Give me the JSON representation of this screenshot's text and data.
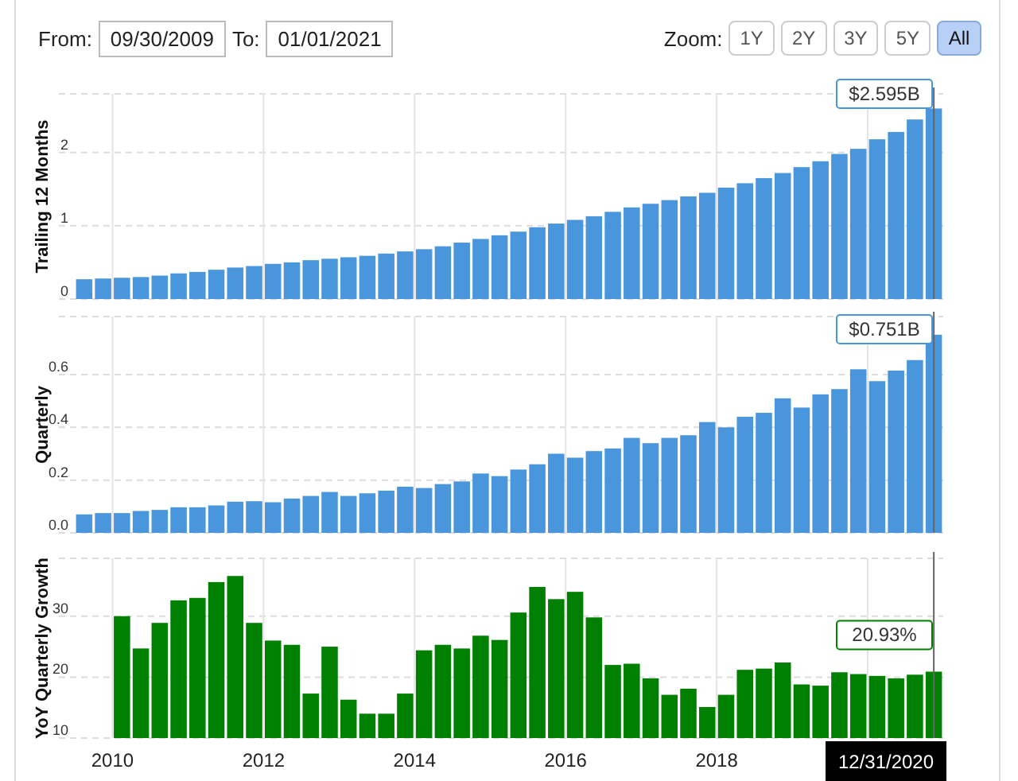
{
  "date_range": {
    "from_label": "From:",
    "from": "09/30/2009",
    "to_label": "To:",
    "to": "01/01/2021"
  },
  "zoom": {
    "label": "Zoom:",
    "options": [
      {
        "label": "1Y",
        "selected": false
      },
      {
        "label": "2Y",
        "selected": false
      },
      {
        "label": "3Y",
        "selected": false
      },
      {
        "label": "5Y",
        "selected": false
      },
      {
        "label": "All",
        "selected": true
      }
    ]
  },
  "charts": [
    {
      "tooltip": "$2.595B",
      "chart_data": {
        "type": "bar",
        "ylabel": "Trailing 12 Months",
        "grid": true,
        "ylim": [
          0,
          2.8
        ],
        "yticks": [
          0,
          1,
          2
        ],
        "series": [
          {
            "color": "#4a96dc",
            "values": [
              0.27,
              0.28,
              0.29,
              0.3,
              0.32,
              0.35,
              0.37,
              0.4,
              0.43,
              0.45,
              0.48,
              0.5,
              0.53,
              0.55,
              0.57,
              0.59,
              0.62,
              0.65,
              0.68,
              0.72,
              0.77,
              0.82,
              0.87,
              0.92,
              0.98,
              1.03,
              1.08,
              1.13,
              1.19,
              1.25,
              1.3,
              1.35,
              1.4,
              1.45,
              1.52,
              1.58,
              1.65,
              1.72,
              1.8,
              1.88,
              1.98,
              2.05,
              2.18,
              2.28,
              2.45,
              2.6
            ]
          }
        ]
      }
    },
    {
      "tooltip": "$0.751B",
      "chart_data": {
        "type": "bar",
        "ylabel": "Quarterly",
        "grid": true,
        "ylim": [
          0,
          0.82
        ],
        "yticks": [
          {
            "value": 0,
            "label": "0.0"
          },
          0.2,
          0.4,
          0.6
        ],
        "series": [
          {
            "color": "#4a96dc",
            "values": [
              0.07,
              0.075,
              0.075,
              0.083,
              0.087,
              0.097,
              0.097,
              0.104,
              0.118,
              0.12,
              0.116,
              0.13,
              0.14,
              0.155,
              0.14,
              0.15,
              0.16,
              0.175,
              0.17,
              0.185,
              0.195,
              0.225,
              0.215,
              0.24,
              0.26,
              0.3,
              0.285,
              0.31,
              0.32,
              0.36,
              0.34,
              0.36,
              0.37,
              0.42,
              0.4,
              0.44,
              0.455,
              0.51,
              0.475,
              0.525,
              0.545,
              0.62,
              0.575,
              0.615,
              0.655,
              0.751
            ]
          }
        ]
      }
    },
    {
      "tooltip": "20.93%",
      "x_axis_labels": [
        "2010",
        "2012",
        "2014",
        "2016",
        "2018"
      ],
      "chart_data": {
        "type": "bar",
        "ylabel": "YoY Quarterly Growth",
        "grid": true,
        "ylim": [
          10,
          39.5
        ],
        "yticks": [
          10,
          20,
          30
        ],
        "series": [
          {
            "color": "#008000",
            "values": [
              null,
              null,
              30,
              24.7,
              28.9,
              32.6,
              33,
              35.6,
              36.6,
              28.9,
              26,
              25.3,
              17.3,
              25,
              16.3,
              14,
              14,
              17.3,
              24.4,
              25.3,
              24.7,
              26.8,
              26.1,
              30.6,
              34.8,
              32.8,
              34,
              29.8,
              22,
              22.2,
              19.8,
              17.1,
              18.1,
              15.1,
              17.1,
              21.2,
              21.4,
              22.4,
              18.8,
              18.6,
              20.8,
              20.5,
              20.2,
              19.8,
              20.4,
              20.9
            ]
          }
        ]
      }
    }
  ],
  "crosshair_date": "12/31/2020"
}
